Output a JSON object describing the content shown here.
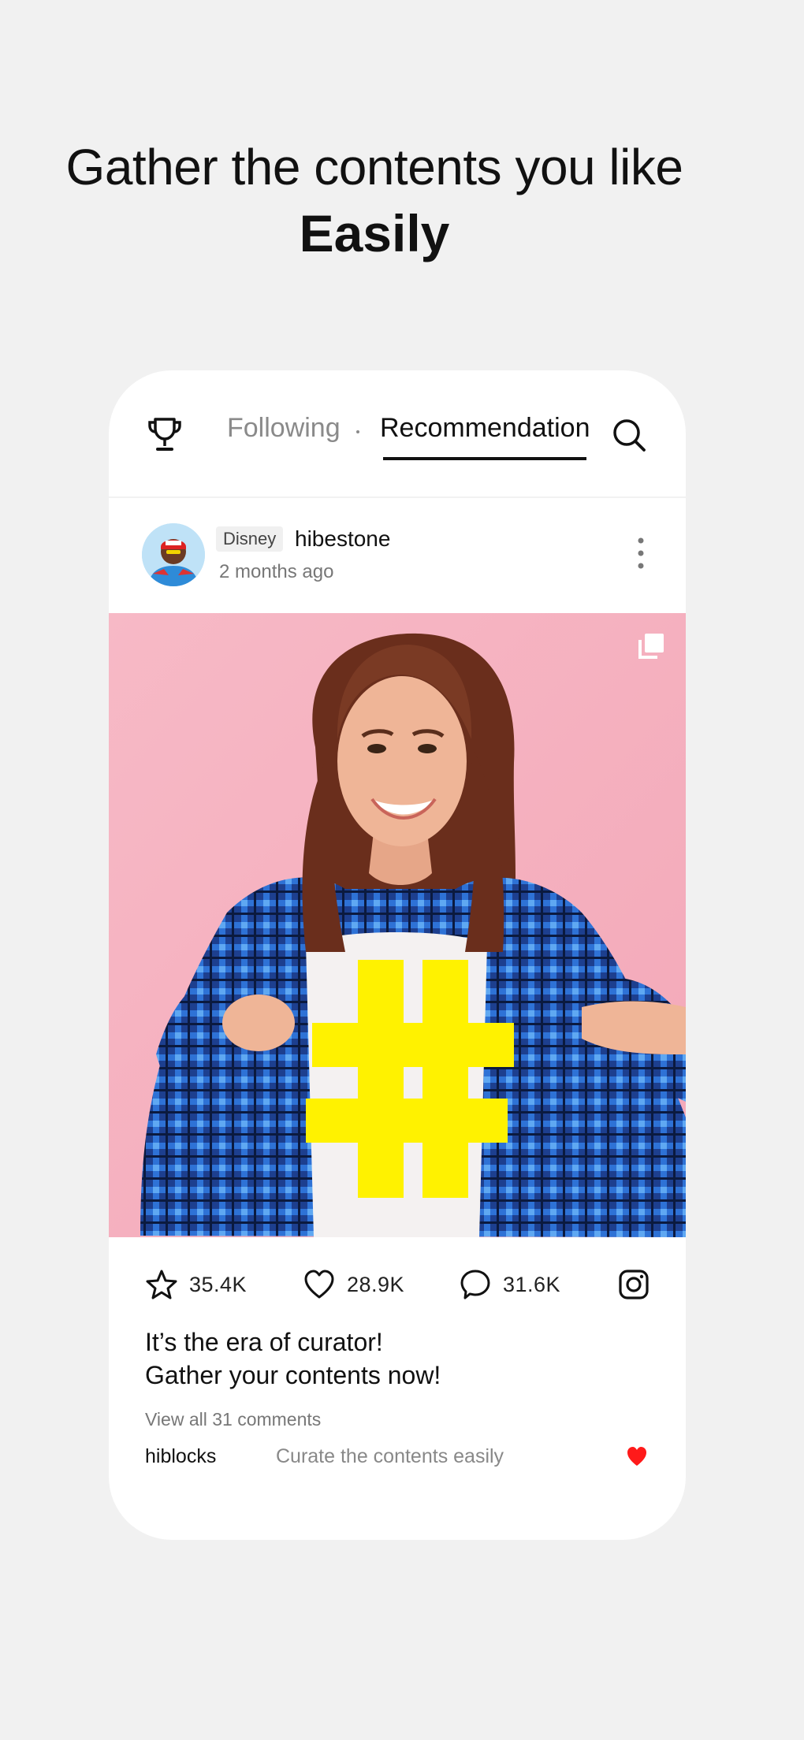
{
  "headline": {
    "line1": "Gather the contents you like",
    "line2": "Easily"
  },
  "topbar": {
    "trophy_icon": "trophy-icon",
    "tabs": [
      {
        "label": "Following",
        "active": false
      },
      {
        "label": "Recommendation",
        "active": true
      }
    ],
    "search_icon": "search-icon"
  },
  "post": {
    "badge": "Disney",
    "username": "hibestone",
    "time": "2 months ago",
    "more_icon": "more-vertical-icon",
    "gallery_icon": "multiple-images-icon",
    "stats": {
      "stars": "35.4K",
      "likes": "28.9K",
      "comments": "31.6K"
    },
    "instagram_icon": "instagram-icon",
    "caption_line1": "It’s the era of curator!",
    "caption_line2": "Gather your contents now!",
    "view_all": "View all 31 comments",
    "comment": {
      "user": "hiblocks",
      "text": "Curate the contents easily"
    }
  },
  "colors": {
    "background": "#f1f1f1",
    "card": "#ffffff",
    "photo_bg": "#f6b5c3",
    "hashtag": "#fff200",
    "heart": "#ff1a1a"
  }
}
